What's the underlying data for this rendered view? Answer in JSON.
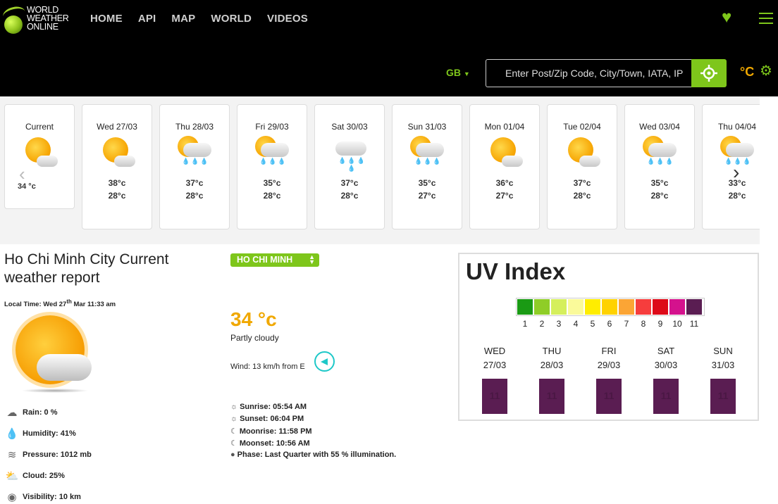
{
  "header": {
    "logo_lines": [
      "WORLD",
      "WEATHER",
      "ONLINE"
    ],
    "nav": [
      "HOME",
      "API",
      "MAP",
      "WORLD",
      "VIDEOS"
    ],
    "country": "GB",
    "search_placeholder": "Enter Post/Zip Code, City/Town, IATA, IP",
    "unit": "°C"
  },
  "forecast": {
    "current": {
      "label": "Current",
      "temp": "34 °c",
      "icon": "sun-cloud-icon"
    },
    "days": [
      {
        "date": "Wed 27/03",
        "hi": "38°c",
        "lo": "28°c",
        "icon": "sun-cloud-icon"
      },
      {
        "date": "Thu 28/03",
        "hi": "37°c",
        "lo": "28°c",
        "icon": "sun-rain-icon"
      },
      {
        "date": "Fri 29/03",
        "hi": "35°c",
        "lo": "28°c",
        "icon": "sun-rain-icon"
      },
      {
        "date": "Sat 30/03",
        "hi": "37°c",
        "lo": "28°c",
        "icon": "cloud-rain-icon"
      },
      {
        "date": "Sun 31/03",
        "hi": "35°c",
        "lo": "27°c",
        "icon": "sun-rain-icon"
      },
      {
        "date": "Mon 01/04",
        "hi": "36°c",
        "lo": "27°c",
        "icon": "sun-cloud-icon"
      },
      {
        "date": "Tue 02/04",
        "hi": "37°c",
        "lo": "28°c",
        "icon": "sun-cloud-icon"
      },
      {
        "date": "Wed 03/04",
        "hi": "35°c",
        "lo": "28°c",
        "icon": "sun-rain-icon"
      },
      {
        "date": "Thu 04/04",
        "hi": "33°c",
        "lo": "28°c",
        "icon": "sun-rain-icon"
      }
    ]
  },
  "report": {
    "title": "Ho Chi Minh City Current weather report",
    "local_time_prefix": "Local Time: Wed 27",
    "local_time_sup": "th",
    "local_time_suffix": " Mar 11:33 am",
    "rain": "Rain: 0 %",
    "humidity": "Humidity: 41%",
    "pressure": "Pressure: 1012 mb",
    "cloud": "Cloud: 25%",
    "visibility": "Visibility: 10 km"
  },
  "current": {
    "city": "HO CHI MINH",
    "temp": "34 °c",
    "condition": "Partly cloudy",
    "wind": "Wind: 13 km/h from E",
    "sunrise": "Sunrise: 05:54 AM",
    "sunset": "Sunset: 06:04 PM",
    "moonrise": "Moonrise: 11:58 PM",
    "moonset": "Moonset: 10:56 AM",
    "phase": "Phase: Last Quarter  with 55 % illumination."
  },
  "uv": {
    "title": "UV Index",
    "scale_colors": [
      "#1a9a14",
      "#8fcd27",
      "#d5ef5c",
      "#fafa9a",
      "#ffed00",
      "#ffd200",
      "#fba535",
      "#f63d3d",
      "#dd0a18",
      "#d4128d",
      "#5a1d52"
    ],
    "scale_labels": [
      "1",
      "2",
      "3",
      "4",
      "5",
      "6",
      "7",
      "8",
      "9",
      "10",
      "11"
    ],
    "days": [
      {
        "day": "WED",
        "date": "27/03",
        "value": "11"
      },
      {
        "day": "THU",
        "date": "28/03",
        "value": "11"
      },
      {
        "day": "FRI",
        "date": "29/03",
        "value": "11"
      },
      {
        "day": "SAT",
        "date": "30/03",
        "value": "11"
      },
      {
        "day": "SUN",
        "date": "31/03",
        "value": "11"
      }
    ]
  }
}
